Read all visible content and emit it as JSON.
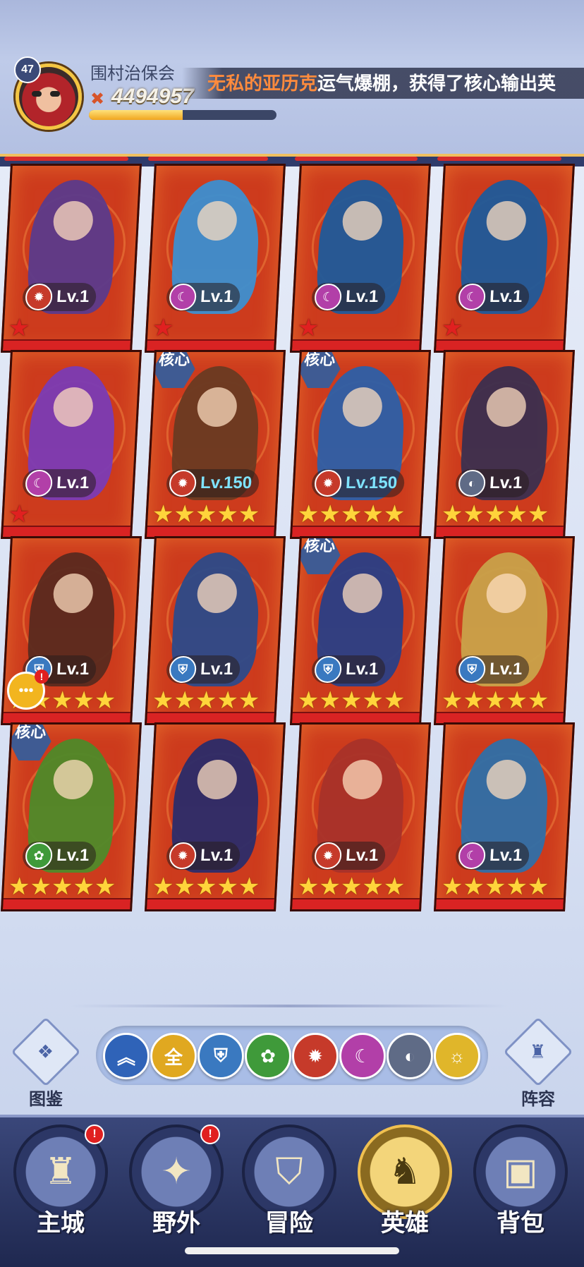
{
  "header": {
    "player_level": "47",
    "player_name": "围村治保会",
    "power_value": "4494957",
    "exp_fraction": 0.5,
    "marquee_name": "无私的亚历克",
    "marquee_text": "运气爆棚，获得了核心输出英"
  },
  "heroes": [
    {
      "level_label": "Lv.1",
      "faction": "fire",
      "stars": 1,
      "star_color": "red",
      "core": false,
      "figure_color": "#5b3a8c"
    },
    {
      "level_label": "Lv.1",
      "faction": "shadow",
      "stars": 1,
      "star_color": "red",
      "core": false,
      "figure_color": "#3d8fd0"
    },
    {
      "level_label": "Lv.1",
      "faction": "shadow",
      "stars": 1,
      "star_color": "red",
      "core": false,
      "figure_color": "#1f5a9a"
    },
    {
      "level_label": "Lv.1",
      "faction": "shadow",
      "stars": 1,
      "star_color": "red",
      "core": false,
      "figure_color": "#1f5a9a"
    },
    {
      "level_label": "Lv.1",
      "faction": "shadow",
      "stars": 1,
      "star_color": "red",
      "core": false,
      "figure_color": "#7b3bb5"
    },
    {
      "level_label": "Lv.150",
      "faction": "fire",
      "stars": 5,
      "star_color": "gold",
      "core": true,
      "core_label": "核心",
      "figure_color": "#6a3a22"
    },
    {
      "level_label": "Lv.150",
      "faction": "fire",
      "stars": 5,
      "star_color": "gold",
      "core": true,
      "core_label": "核心",
      "figure_color": "#2d5fa8"
    },
    {
      "level_label": "Lv.1",
      "faction": "dark",
      "stars": 5,
      "star_color": "gold",
      "core": false,
      "figure_color": "#3b2f4f"
    },
    {
      "level_label": "Lv.1",
      "faction": "water",
      "stars": 5,
      "star_color": "gold",
      "core": false,
      "figure_color": "#5a2a1f"
    },
    {
      "level_label": "Lv.1",
      "faction": "water",
      "stars": 5,
      "star_color": "gold",
      "core": false,
      "figure_color": "#2c4a8a"
    },
    {
      "level_label": "Lv.1",
      "faction": "water",
      "stars": 5,
      "star_color": "gold",
      "core": true,
      "core_label": "核心",
      "figure_color": "#2a3f86"
    },
    {
      "level_label": "Lv.1",
      "faction": "water",
      "stars": 5,
      "star_color": "gold",
      "core": false,
      "figure_color": "#c9a24a"
    },
    {
      "level_label": "Lv.1",
      "faction": "nature",
      "stars": 5,
      "star_color": "gold",
      "core": true,
      "core_label": "核心",
      "figure_color": "#4f8a2a"
    },
    {
      "level_label": "Lv.1",
      "faction": "fire",
      "stars": 5,
      "star_color": "gold",
      "core": false,
      "figure_color": "#2b2c6a"
    },
    {
      "level_label": "Lv.1",
      "faction": "fire",
      "stars": 5,
      "star_color": "gold",
      "core": false,
      "figure_color": "#a8322a"
    },
    {
      "level_label": "Lv.1",
      "faction": "shadow",
      "stars": 5,
      "star_color": "gold",
      "core": false,
      "figure_color": "#2f6fa8"
    }
  ],
  "factions": {
    "fire": {
      "color": "#c63a2a",
      "glyph": "✹"
    },
    "shadow": {
      "color": "#b23fa8",
      "glyph": "☾"
    },
    "dark": {
      "color": "#5f6b86",
      "glyph": "◐"
    },
    "water": {
      "color": "#3a79c0",
      "glyph": "⛨"
    },
    "nature": {
      "color": "#3f9a3a",
      "glyph": "✿"
    }
  },
  "filters": [
    {
      "id": "collapse",
      "label": "︽",
      "color": "#2f63b8"
    },
    {
      "id": "all",
      "label": "全",
      "color": "#e0a820"
    },
    {
      "id": "water",
      "label": "⛨",
      "color": "#3a79c0"
    },
    {
      "id": "nature",
      "label": "✿",
      "color": "#3f9a3a"
    },
    {
      "id": "fire",
      "label": "✹",
      "color": "#c63a2a"
    },
    {
      "id": "shadow",
      "label": "☾",
      "color": "#b23fa8"
    },
    {
      "id": "dark",
      "label": "◐",
      "color": "#5f6b86"
    },
    {
      "id": "light",
      "label": "☼",
      "color": "#e0b62a"
    }
  ],
  "side_buttons": {
    "handbook_label": "图鉴",
    "lineup_label": "阵容"
  },
  "nav": [
    {
      "label": "主城",
      "icon": "castle-icon",
      "glyph": "♜",
      "alert": true,
      "active": false
    },
    {
      "label": "野外",
      "icon": "map-scroll-icon",
      "glyph": "✦",
      "alert": true,
      "active": false
    },
    {
      "label": "冒险",
      "icon": "shield-icon",
      "glyph": "⛉",
      "alert": false,
      "active": false
    },
    {
      "label": "英雄",
      "icon": "helmet-icon",
      "glyph": "♞",
      "alert": false,
      "active": true
    },
    {
      "label": "背包",
      "icon": "backpack-icon",
      "glyph": "▣",
      "alert": false,
      "active": false
    }
  ]
}
